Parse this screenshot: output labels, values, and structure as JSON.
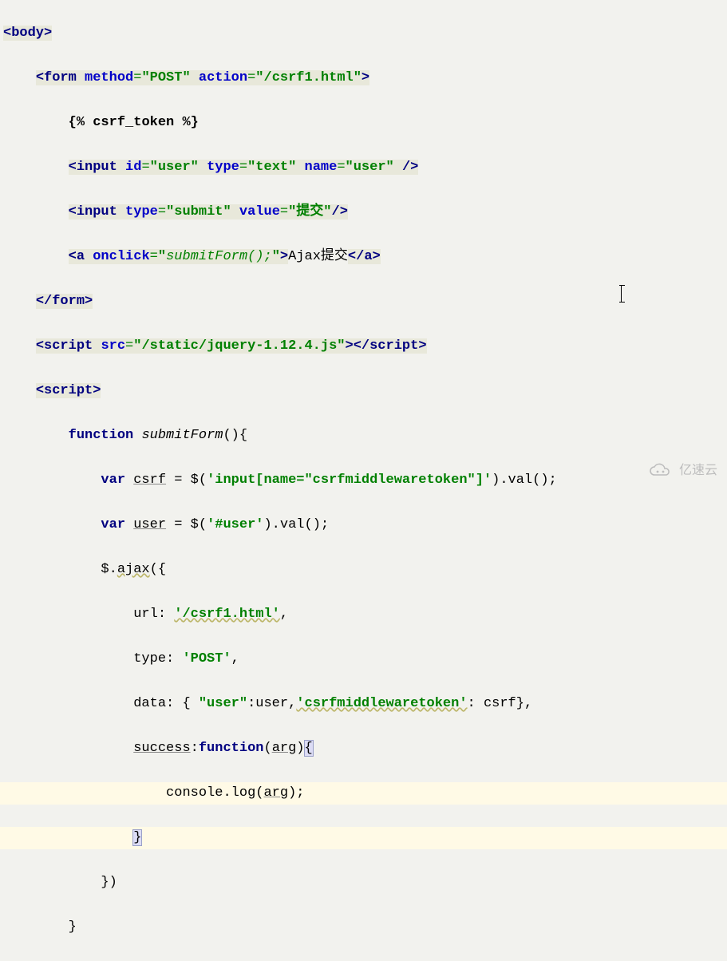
{
  "watermark": {
    "label": "亿速云"
  },
  "code": {
    "l1": {
      "a": "<",
      "b": "body",
      "c": ">"
    },
    "l2": {
      "a": "<",
      "b": "form ",
      "c": "method",
      "d": "=",
      "e": "\"POST\"",
      "f": " ",
      "g": "action",
      "h": "=",
      "i": "\"/csrf1.html\"",
      "j": ">"
    },
    "l3": {
      "a": "{% csrf_token %}"
    },
    "l4": {
      "a": "<",
      "b": "input ",
      "c": "id",
      "d": "=",
      "e": "\"user\"",
      "f": " ",
      "g": "type",
      "h": "=",
      "i": "\"text\"",
      "j": " ",
      "k": "name",
      "l": "=",
      "m": "\"user\"",
      "n": " />"
    },
    "l5": {
      "a": "<",
      "b": "input ",
      "c": "type",
      "d": "=",
      "e": "\"submit\"",
      "f": " ",
      "g": "value",
      "h": "=",
      "i": "\"提交\"",
      "j": "/>"
    },
    "l6": {
      "a": "<",
      "b": "a ",
      "c": "onclick",
      "d": "=",
      "e": "\"",
      "f": "submitForm();",
      "g": "\"",
      "h": ">",
      "i": "Ajax提交",
      "j": "</",
      "k": "a",
      "l": ">"
    },
    "l7": {
      "a": "</",
      "b": "form",
      "c": ">"
    },
    "l8": {
      "a": "<",
      "b": "script ",
      "c": "src",
      "d": "=",
      "e": "\"/static/jquery-1.12.4.js\"",
      "f": "></",
      "g": "script",
      "h": ">"
    },
    "l9": {
      "a": "<",
      "b": "script",
      "c": ">"
    },
    "l10": {
      "a": "function ",
      "b": "submitForm",
      "c": "(){",
      "open": "{"
    },
    "l11": {
      "a": "var ",
      "b": "csrf",
      "c": " = ",
      "d": "$",
      "e": "(",
      "f": "'input[name=\"csrfmiddlewaretoken\"]'",
      "g": ").",
      "h": "val",
      "i": "();"
    },
    "l12": {
      "a": "var ",
      "b": "user",
      "c": " = ",
      "d": "$",
      "e": "(",
      "f": "'#user'",
      "g": ").",
      "h": "val",
      "i": "();"
    },
    "l13": {
      "a": "$",
      "b": ".",
      "c": "ajax",
      "d": "({"
    },
    "l14": {
      "a": "url",
      "b": ": ",
      "c": "'/csrf1.html'",
      "d": ","
    },
    "l15": {
      "a": "type",
      "b": ": ",
      "c": "'POST'",
      "d": ","
    },
    "l16": {
      "a": "data",
      "b": ": { ",
      "c": "\"user\"",
      "d": ":",
      "e": "user",
      "f": ",",
      "g": "'csrfmiddlewaretoken'",
      "h": ": ",
      "i": "csrf",
      "j": "},"
    },
    "l17": {
      "a": "success",
      "b": ":",
      "c": "function",
      "d": "(",
      "e": "arg",
      "f": ")",
      "g": "{"
    },
    "l18": {
      "a": "console",
      "b": ".",
      "c": "log",
      "d": "(",
      "e": "arg",
      "f": ");"
    },
    "l19": {
      "a": "}"
    },
    "l20": {
      "a": "})"
    },
    "l21": {
      "a": "}"
    }
  }
}
